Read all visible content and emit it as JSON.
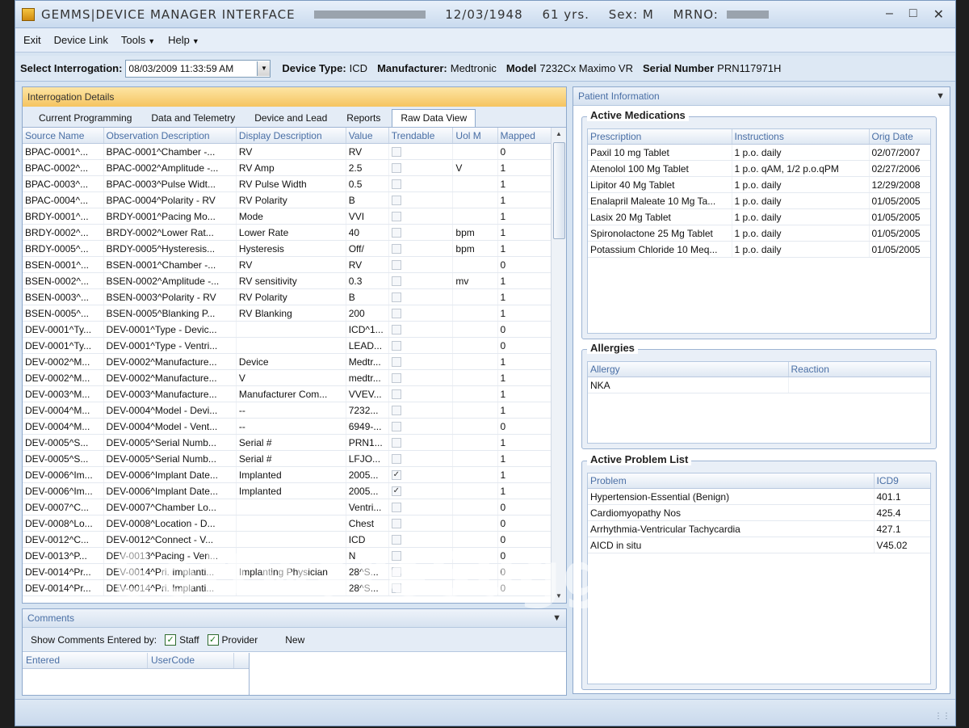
{
  "window": {
    "title": "GEMMS|DEVICE MANAGER INTERFACE",
    "dob": "12/03/1948",
    "age": "61 yrs.",
    "sex": "Sex: M",
    "mrno_label": "MRNO:"
  },
  "menu": {
    "exit": "Exit",
    "device_link": "Device Link",
    "tools": "Tools",
    "help": "Help"
  },
  "interrogation": {
    "select_label": "Select Interrogation:",
    "selected": "08/03/2009 11:33:59 AM",
    "device_type_label": "Device Type:",
    "device_type": "ICD",
    "manufacturer_label": "Manufacturer:",
    "manufacturer": "Medtronic",
    "model_label": "Model",
    "model": "7232Cx Maximo VR",
    "serial_label": "Serial Number",
    "serial": "PRN117971H"
  },
  "details": {
    "header": "Interrogation Details",
    "tabs": [
      "Current Programming",
      "Data and Telemetry",
      "Device and Lead",
      "Reports",
      "Raw Data View"
    ],
    "active_tab": 4,
    "columns": [
      "Source Name",
      "Observation Description",
      "Display Description",
      "Value",
      "Trendable",
      "Uol M",
      "Mapped"
    ],
    "rows": [
      [
        "BPAC-0001^...",
        "BPAC-0001^Chamber -...",
        "RV",
        "RV",
        false,
        "",
        "0"
      ],
      [
        "BPAC-0002^...",
        "BPAC-0002^Amplitude -...",
        "RV Amp",
        "2.5",
        false,
        "V",
        "1"
      ],
      [
        "BPAC-0003^...",
        "BPAC-0003^Pulse Widt...",
        "RV Pulse Width",
        "0.5",
        false,
        "",
        "1"
      ],
      [
        "BPAC-0004^...",
        "BPAC-0004^Polarity - RV",
        "RV Polarity",
        "B",
        false,
        "",
        "1"
      ],
      [
        "BRDY-0001^...",
        "BRDY-0001^Pacing Mo...",
        "Mode",
        "VVI",
        false,
        "",
        "1"
      ],
      [
        "BRDY-0002^...",
        "BRDY-0002^Lower Rat...",
        "Lower Rate",
        "40",
        false,
        "bpm",
        "1"
      ],
      [
        "BRDY-0005^...",
        "BRDY-0005^Hysteresis...",
        "Hysteresis",
        "Off/",
        false,
        "bpm",
        "1"
      ],
      [
        "BSEN-0001^...",
        "BSEN-0001^Chamber -...",
        "RV",
        "RV",
        false,
        "",
        "0"
      ],
      [
        "BSEN-0002^...",
        "BSEN-0002^Amplitude -...",
        "RV sensitivity",
        "0.3",
        false,
        "mv",
        "1"
      ],
      [
        "BSEN-0003^...",
        "BSEN-0003^Polarity - RV",
        "RV Polarity",
        "B",
        false,
        "",
        "1"
      ],
      [
        "BSEN-0005^...",
        "BSEN-0005^Blanking P...",
        "RV Blanking",
        "200",
        false,
        "",
        "1"
      ],
      [
        "DEV-0001^Ty...",
        "DEV-0001^Type - Devic...",
        "",
        "ICD^1...",
        false,
        "",
        "0"
      ],
      [
        "DEV-0001^Ty...",
        "DEV-0001^Type - Ventri...",
        "",
        "LEAD...",
        false,
        "",
        "0"
      ],
      [
        "DEV-0002^M...",
        "DEV-0002^Manufacture...",
        "Device",
        "Medtr...",
        false,
        "",
        "1"
      ],
      [
        "DEV-0002^M...",
        "DEV-0002^Manufacture...",
        "V",
        "medtr...",
        false,
        "",
        "1"
      ],
      [
        "DEV-0003^M...",
        "DEV-0003^Manufacture...",
        "Manufacturer Com...",
        "VVEV...",
        false,
        "",
        "1"
      ],
      [
        "DEV-0004^M...",
        "DEV-0004^Model - Devi...",
        "--",
        "7232...",
        false,
        "",
        "1"
      ],
      [
        "DEV-0004^M...",
        "DEV-0004^Model - Vent...",
        "--",
        "6949-...",
        false,
        "",
        "0"
      ],
      [
        "DEV-0005^S...",
        "DEV-0005^Serial Numb...",
        "Serial #",
        "PRN1...",
        false,
        "",
        "1"
      ],
      [
        "DEV-0005^S...",
        "DEV-0005^Serial Numb...",
        "Serial #",
        "LFJO...",
        false,
        "",
        "1"
      ],
      [
        "DEV-0006^Im...",
        "DEV-0006^Implant Date...",
        "Implanted",
        "2005...",
        true,
        "",
        "1"
      ],
      [
        "DEV-0006^Im...",
        "DEV-0006^Implant Date...",
        "Implanted",
        "2005...",
        true,
        "",
        "1"
      ],
      [
        "DEV-0007^C...",
        "DEV-0007^Chamber Lo...",
        "",
        "Ventri...",
        false,
        "",
        "0"
      ],
      [
        "DEV-0008^Lo...",
        "DEV-0008^Location - D...",
        "",
        "Chest",
        false,
        "",
        "0"
      ],
      [
        "DEV-0012^C...",
        "DEV-0012^Connect - V...",
        "",
        "ICD",
        false,
        "",
        "0"
      ],
      [
        "DEV-0013^P...",
        "DEV-0013^Pacing - Ven...",
        "",
        "N",
        false,
        "",
        "0"
      ],
      [
        "DEV-0014^Pr...",
        "DEV-0014^Pri. Implanti...",
        "Implanting Physician",
        "28^S...",
        false,
        "",
        "0"
      ],
      [
        "DEV-0014^Pr...",
        "DEV-0014^Pri. Implanti...",
        "",
        "28^S...",
        false,
        "",
        "0"
      ]
    ]
  },
  "comments": {
    "header": "Comments",
    "show_label": "Show Comments Entered by:",
    "staff": "Staff",
    "provider": "Provider",
    "new_label": "New",
    "columns": [
      "Entered",
      "UserCode"
    ]
  },
  "patient": {
    "header": "Patient Information",
    "medications": {
      "title": "Active Medications",
      "columns": [
        "Prescription",
        "Instructions",
        "Orig Date"
      ],
      "rows": [
        [
          "Paxil 10 mg Tablet",
          "1 p.o. daily",
          "02/07/2007"
        ],
        [
          "Atenolol 100 Mg Tablet",
          "1 p.o. qAM, 1/2 p.o.qPM",
          "02/27/2006"
        ],
        [
          "Lipitor 40 Mg Tablet",
          "1 p.o. daily",
          "12/29/2008"
        ],
        [
          "Enalapril Maleate 10 Mg Ta...",
          "1 p.o. daily",
          "01/05/2005"
        ],
        [
          "Lasix 20 Mg Tablet",
          "1 p.o. daily",
          "01/05/2005"
        ],
        [
          "Spironolactone 25 Mg Tablet",
          "1 p.o. daily",
          "01/05/2005"
        ],
        [
          "Potassium Chloride 10 Meq...",
          "1 p.o. daily",
          "01/05/2005"
        ]
      ]
    },
    "allergies": {
      "title": "Allergies",
      "columns": [
        "Allergy",
        "Reaction"
      ],
      "rows": [
        [
          "NKA",
          ""
        ]
      ]
    },
    "problems": {
      "title": "Active Problem List",
      "columns": [
        "Problem",
        "ICD9"
      ],
      "rows": [
        [
          "Hypertension-Essential (Benign)",
          "401.1"
        ],
        [
          "Cardiomyopathy Nos",
          "425.4"
        ],
        [
          "Arrhythmia-Ventricular Tachycardia",
          "427.1"
        ],
        [
          "AICD in situ",
          "V45.02"
        ]
      ]
    }
  },
  "watermark": {
    "main": "SoftwareSuggest",
    "suffix": ".com"
  }
}
